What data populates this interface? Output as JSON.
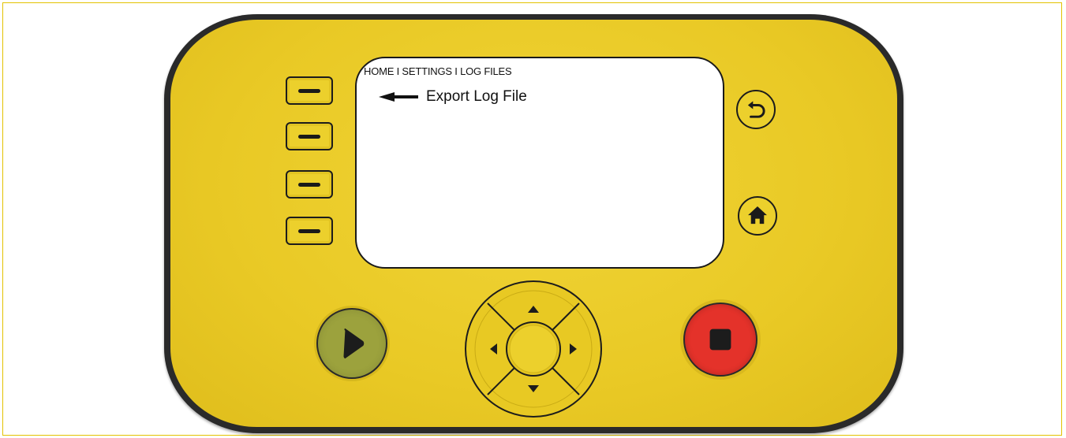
{
  "screen": {
    "breadcrumb": "HOME I SETTINGS I LOG FILES",
    "menu_item": "Export Log File"
  },
  "controls": {
    "softkeys": 4,
    "icons": {
      "back": "back-arrow-icon",
      "home": "home-icon",
      "play": "play-icon",
      "stop": "stop-icon",
      "menu_pointer": "arrow-left-icon"
    }
  },
  "colors": {
    "faceplate": "#e9c925",
    "bezel": "#2a2a2a",
    "play_button": "#9ca23d",
    "stop_button": "#e4322a",
    "screen": "#ffffff",
    "frame_border": "#e3c200"
  }
}
